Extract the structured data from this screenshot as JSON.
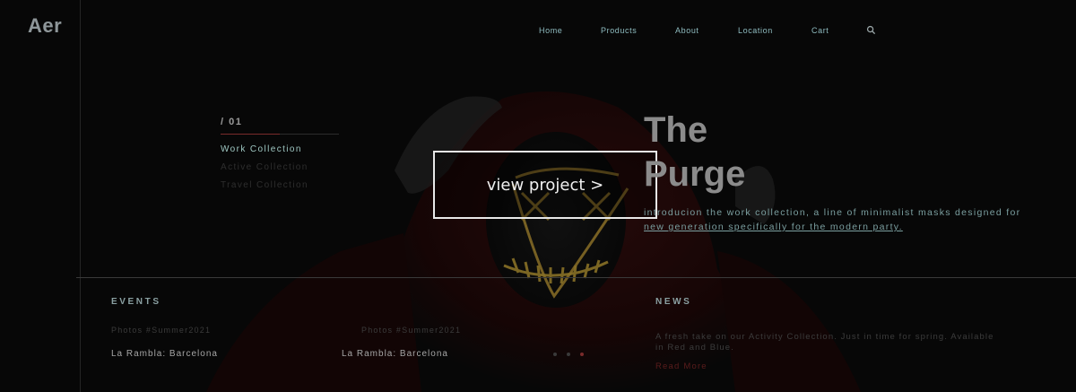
{
  "brand": {
    "logo": "Aer"
  },
  "nav": {
    "items": [
      "Home",
      "Products",
      "About",
      "Location",
      "Cart"
    ],
    "search_icon": "search-icon"
  },
  "hero": {
    "slide_number": "/ 01",
    "collections": [
      "Work Collection",
      "Active Collection",
      "Travel Collection"
    ],
    "active_collection": "Work Collection",
    "view_button": "view project >",
    "title_line1": "The",
    "title_line2": "Purge",
    "description_line1": "introducion the work collection, a line of minimalist masks designed for",
    "description_line2": "new generation specifically for the modern party."
  },
  "events": {
    "heading": "EVENTS",
    "items": [
      {
        "tag": "Photos #Summer2021",
        "location": "La Rambla: Barcelona"
      },
      {
        "tag": "Photos #Summer2021",
        "location": "La Rambla: Barcelona"
      }
    ],
    "carousel_active_index": 2
  },
  "news": {
    "heading": "NEWS",
    "text_line1": "A fresh take on our Activity Collection. Just in time for spring. Available",
    "text_line2": "in Red and Blue.",
    "read_more": "Read More"
  },
  "colors": {
    "background": "#0c0c0c",
    "accent_teal": "#8fbcc0",
    "accent_red": "#7a2b2b",
    "mask_glow": "#c9a23a"
  }
}
